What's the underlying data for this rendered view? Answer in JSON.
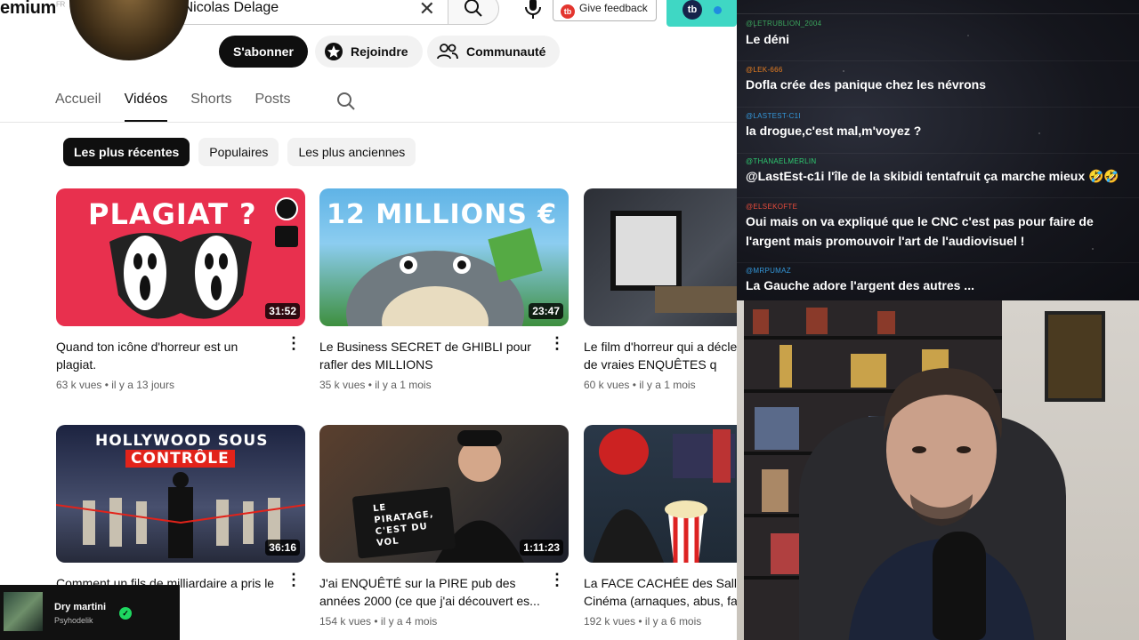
{
  "header": {
    "brand": "emium",
    "brand_sup": "FR",
    "search_value": "Paf & Nicolas Delage",
    "feedback_label": "Give feedback",
    "ext_label": "tb"
  },
  "channel": {
    "subscribe_label": "S'abonner",
    "join_label": "Rejoindre",
    "community_label": "Communauté"
  },
  "tabs": [
    {
      "label": "Accueil",
      "active": false
    },
    {
      "label": "Vidéos",
      "active": true
    },
    {
      "label": "Shorts",
      "active": false
    },
    {
      "label": "Posts",
      "active": false
    }
  ],
  "chips": [
    {
      "label": "Les plus récentes",
      "selected": true
    },
    {
      "label": "Populaires",
      "selected": false
    },
    {
      "label": "Les plus anciennes",
      "selected": false
    }
  ],
  "videos": [
    {
      "thumb_text": "PLAGIAT ?",
      "duration": "31:52",
      "title": "Quand ton icône d'horreur est un plagiat.",
      "views": "63 k vues",
      "age": "il y a 13 jours",
      "bg": "#e8304e"
    },
    {
      "thumb_text": "12 MILLIONS €",
      "duration": "23:47",
      "title": "Le Business SECRET de GHIBLI pour rafler des MILLIONS",
      "views": "35 k vues",
      "age": "il y a 1 mois",
      "bg": "#5fb3e6"
    },
    {
      "thumb_text": "",
      "duration": "",
      "title": "Le film d'horreur qui a déclenché plus de vraies ENQUÊTES q",
      "views": "60 k vues",
      "age": "il y a 1 mois",
      "bg": "#2c2f36"
    },
    {
      "thumb_text": "HOLLYWOOD SOUS",
      "thumb_text2": "CONTRÔLE",
      "duration": "36:16",
      "title": "Comment un fils de milliardaire a pris le contrôle d'Hollywood",
      "views": "",
      "age": "",
      "bg": "#3a3f58"
    },
    {
      "thumb_text": "LE PIRATAGE, C'EST DU VOL",
      "duration": "1:11:23",
      "title": "J'ai ENQUÊTÉ sur la PIRE pub des années 2000 (ce que j'ai découvert es...",
      "views": "154 k vues",
      "age": "il y a 4 mois",
      "bg": "#3b3530"
    },
    {
      "thumb_text": "",
      "duration": "",
      "title": "La FACE CACHÉE des Salles de Cinéma (arnaques, abus, fa",
      "views": "192 k vues",
      "age": "il y a 6 mois",
      "bg": "#1f2a36"
    }
  ],
  "spotify": {
    "song": "Dry martini",
    "artist": "Psyhodelik"
  },
  "chat": [
    {
      "user": "@LETRUBLION_2004",
      "text": "Le déni",
      "color": "#3ba55d"
    },
    {
      "user": "@LEK-666",
      "text": "Dofla crée des panique chez les névrons",
      "color": "#e67e22"
    },
    {
      "user": "@LASTEST-C1I",
      "text": "la drogue,c'est mal,m'voyez ?",
      "color": "#3498db"
    },
    {
      "user": "@THANAELMERLIN",
      "text": "@LastEst-c1i l'île de la skibidi tentafruit ça marche mieux 🤣🤣",
      "color": "#2ecc71"
    },
    {
      "user": "@ELSEKOFTE",
      "text": "Oui mais on va expliqué que le CNC c'est pas pour faire de l'argent mais promouvoir l'art de l'audiovisuel !",
      "color": "#e74c3c"
    },
    {
      "user": "@MRPUMAZ",
      "text": "La Gauche adore l'argent des autres ...",
      "color": "#3498db"
    }
  ]
}
